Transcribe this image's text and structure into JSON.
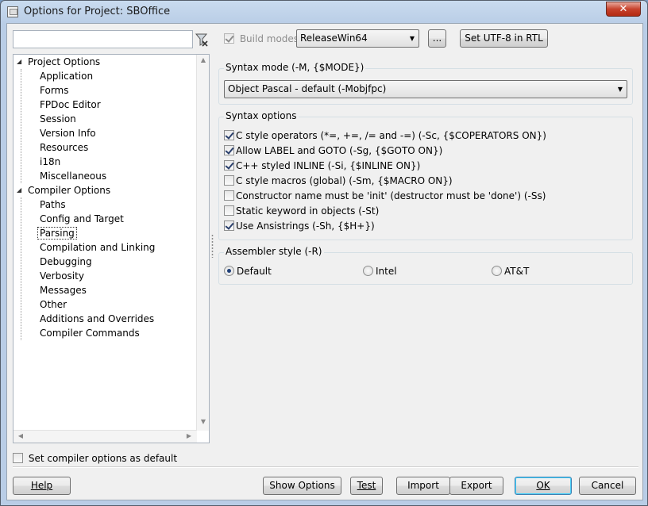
{
  "window": {
    "title": "Options for Project: SBOffice",
    "close_glyph": "✕"
  },
  "filter": {
    "value": "",
    "icon": "filter-clear-icon"
  },
  "tree": {
    "items": [
      {
        "label": "Project Options",
        "level": 0,
        "expanded": true
      },
      {
        "label": "Application",
        "level": 1
      },
      {
        "label": "Forms",
        "level": 1
      },
      {
        "label": "FPDoc Editor",
        "level": 1
      },
      {
        "label": "Session",
        "level": 1
      },
      {
        "label": "Version Info",
        "level": 1
      },
      {
        "label": "Resources",
        "level": 1
      },
      {
        "label": "i18n",
        "level": 1
      },
      {
        "label": "Miscellaneous",
        "level": 1
      },
      {
        "label": "Compiler Options",
        "level": 0,
        "expanded": true
      },
      {
        "label": "Paths",
        "level": 1
      },
      {
        "label": "Config and Target",
        "level": 1
      },
      {
        "label": "Parsing",
        "level": 1,
        "selected": true
      },
      {
        "label": "Compilation and Linking",
        "level": 1
      },
      {
        "label": "Debugging",
        "level": 1
      },
      {
        "label": "Verbosity",
        "level": 1
      },
      {
        "label": "Messages",
        "level": 1
      },
      {
        "label": "Other",
        "level": 1
      },
      {
        "label": "Additions and Overrides",
        "level": 1
      },
      {
        "label": "Compiler Commands",
        "level": 1
      }
    ]
  },
  "build_modes": {
    "label": "Build modes",
    "checked": true,
    "selected": "ReleaseWin64",
    "ellipsis": "...",
    "utf8_button": "Set UTF-8 in RTL"
  },
  "syntax_mode": {
    "title": "Syntax mode (-M, {$MODE})",
    "selected": "Object Pascal - default (-Mobjfpc)"
  },
  "syntax_options": {
    "title": "Syntax options",
    "items": [
      {
        "label": "C style operators (*=, +=, /= and -=) (-Sc, {$COPERATORS ON})",
        "checked": true
      },
      {
        "label": "Allow LABEL and GOTO (-Sg, {$GOTO ON})",
        "checked": true
      },
      {
        "label": "C++ styled INLINE (-Si, {$INLINE ON})",
        "checked": true
      },
      {
        "label": "C style macros (global) (-Sm, {$MACRO ON})",
        "checked": false
      },
      {
        "label": "Constructor name must be 'init' (destructor must be 'done') (-Ss)",
        "checked": false
      },
      {
        "label": "Static keyword in objects (-St)",
        "checked": false
      },
      {
        "label": "Use Ansistrings (-Sh, {$H+})",
        "checked": true
      }
    ]
  },
  "assembler": {
    "title": "Assembler style (-R)",
    "options": [
      {
        "label": "Default",
        "checked": true
      },
      {
        "label": "Intel",
        "checked": false
      },
      {
        "label": "AT&T",
        "checked": false
      }
    ]
  },
  "default_checkbox": {
    "label": "Set compiler options as default",
    "checked": false
  },
  "buttons": {
    "help": "Help",
    "show_options": "Show Options",
    "test": "Test",
    "import": "Import",
    "export": "Export",
    "ok": "OK",
    "cancel": "Cancel"
  }
}
